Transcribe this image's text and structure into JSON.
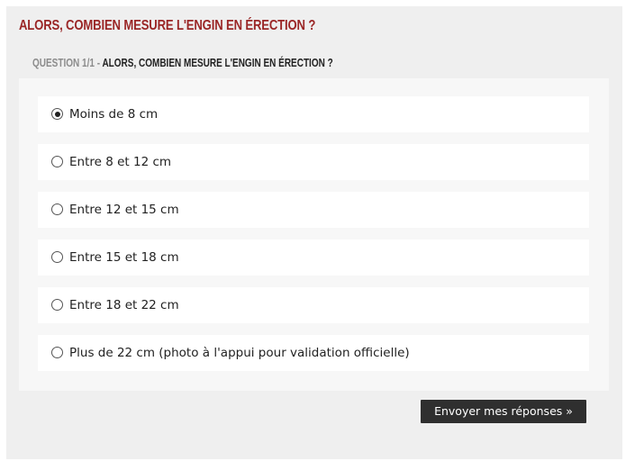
{
  "poll": {
    "title": "ALORS, COMBIEN MESURE L'ENGIN EN ÉRECTION ?",
    "question_number": "QUESTION 1/1",
    "question_separator": " - ",
    "question_text": "ALORS, COMBIEN MESURE L'ENGIN EN ÉRECTION ?"
  },
  "options": [
    {
      "label": "Moins de 8 cm",
      "selected": true
    },
    {
      "label": "Entre 8 et 12 cm",
      "selected": false
    },
    {
      "label": "Entre 12 et 15 cm",
      "selected": false
    },
    {
      "label": "Entre 15 et 18 cm",
      "selected": false
    },
    {
      "label": "Entre 18 et 22 cm",
      "selected": false
    },
    {
      "label": "Plus de 22 cm (photo à l'appui pour validation officielle)",
      "selected": false
    }
  ],
  "submit_label": "Envoyer mes réponses »",
  "colors": {
    "title_red": "#9a2626",
    "button_bg": "#2f2f2f",
    "panel_bg": "#efefef"
  }
}
